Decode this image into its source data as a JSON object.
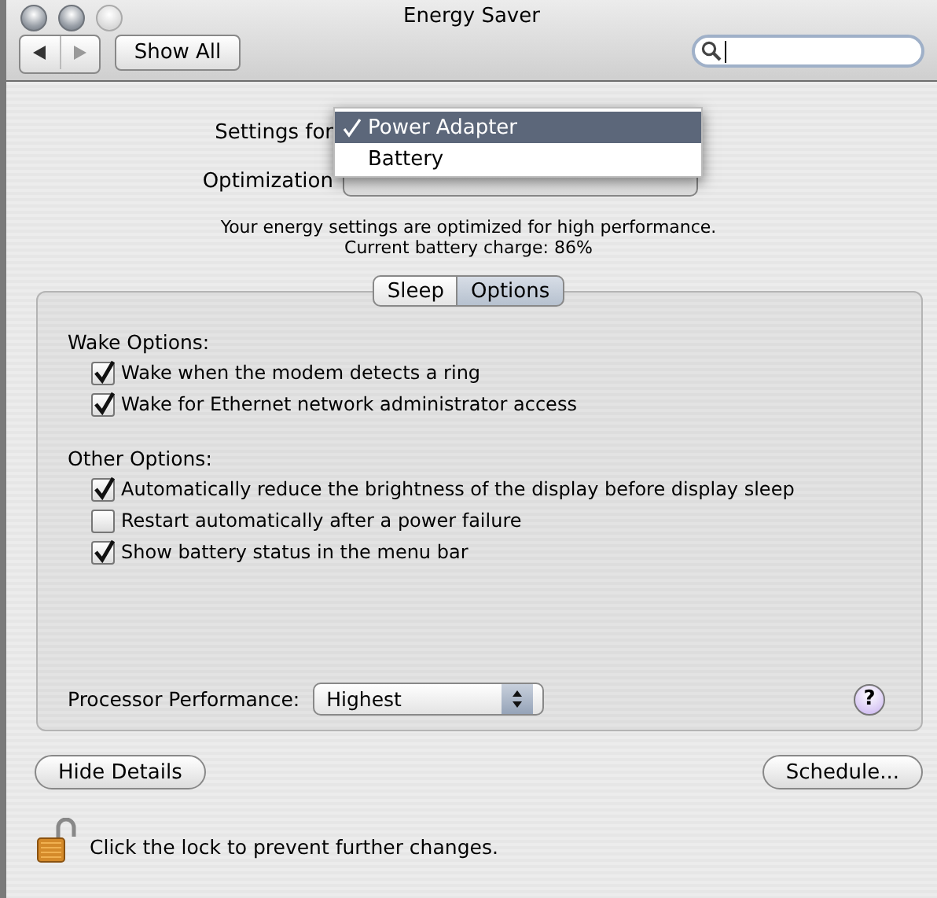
{
  "window": {
    "title": "Energy Saver"
  },
  "toolbar": {
    "show_all": "Show All"
  },
  "settings_for": {
    "label": "Settings for",
    "menu": [
      {
        "label": "Power Adapter",
        "selected": true
      },
      {
        "label": "Battery",
        "selected": false
      }
    ]
  },
  "optimization": {
    "label": "Optimization"
  },
  "info": [
    "Your energy settings are optimized for high performance.",
    "Current battery charge: 86%"
  ],
  "tabs": [
    {
      "label": "Sleep",
      "selected": false
    },
    {
      "label": "Options",
      "selected": true
    }
  ],
  "groups": [
    {
      "title": "Wake Options:",
      "options": [
        {
          "label": "Wake when the modem detects a ring",
          "checked": true
        },
        {
          "label": "Wake for Ethernet network administrator access",
          "checked": true
        }
      ]
    },
    {
      "title": "Other Options:",
      "options": [
        {
          "label": "Automatically reduce the brightness of the display before display sleep",
          "checked": true
        },
        {
          "label": "Restart automatically after a power failure",
          "checked": false
        },
        {
          "label": "Show battery status in the menu bar",
          "checked": true
        }
      ]
    }
  ],
  "processor": {
    "label": "Processor Performance:",
    "value": "Highest"
  },
  "help": "?",
  "buttons": {
    "hide_details": "Hide Details",
    "schedule": "Schedule..."
  },
  "lock_text": "Click the lock to prevent further changes."
}
